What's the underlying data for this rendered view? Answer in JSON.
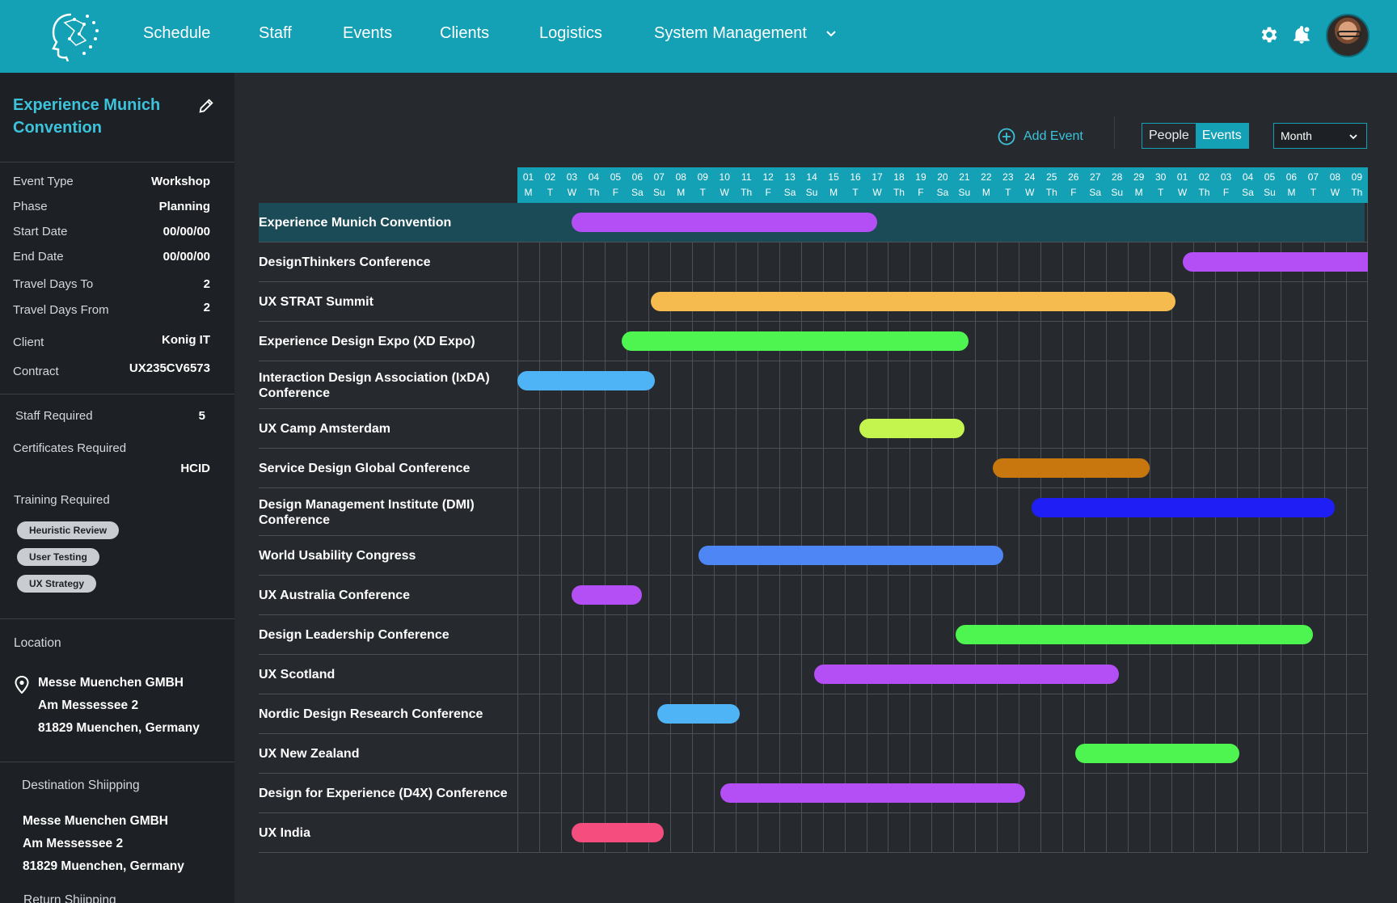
{
  "nav": {
    "items": [
      "Schedule",
      "Staff",
      "Events",
      "Clients",
      "Logistics",
      "System Management"
    ]
  },
  "event": {
    "title": "Experience Munich Convention",
    "details": [
      {
        "label": "Event Type",
        "value": "Workshop"
      },
      {
        "label": "Phase",
        "value": "Planning"
      },
      {
        "label": "Start Date",
        "value": "00/00/00"
      },
      {
        "label": "End Date",
        "value": "00/00/00"
      },
      {
        "label": "Travel Days To",
        "value": "2"
      },
      {
        "label": "Travel Days From",
        "value": "2"
      },
      {
        "label": "Client",
        "value": "Konig IT"
      },
      {
        "label": "Contract",
        "value": "UX235CV6573"
      }
    ],
    "staff_required_label": "Staff Required",
    "staff_required_value": "5",
    "certificates_label": "Certificates Required",
    "certificates_value": "HCID",
    "training_label": "Training Required",
    "training_chips": [
      "Heuristic Review",
      "User Testing",
      "UX Strategy"
    ],
    "location_label": "Location",
    "location_lines": [
      "Messe Muenchen GMBH",
      "Am Messessee 2",
      "81829 Muenchen, Germany"
    ],
    "dest_shipping_label": "Destination Shiipping",
    "dest_shipping_lines": [
      "Messe Muenchen GMBH",
      "Am Messessee 2",
      "81829 Muenchen, Germany"
    ],
    "return_shipping_label": "Return Shiipping"
  },
  "toolbar": {
    "add_event_label": "Add Event",
    "toggle": [
      "People",
      "Events"
    ],
    "active_toggle": "Events",
    "view_select": "Month"
  },
  "days": [
    {
      "d": "01",
      "w": "M"
    },
    {
      "d": "02",
      "w": "T"
    },
    {
      "d": "03",
      "w": "W"
    },
    {
      "d": "04",
      "w": "Th"
    },
    {
      "d": "05",
      "w": "F"
    },
    {
      "d": "06",
      "w": "Sa"
    },
    {
      "d": "07",
      "w": "Su"
    },
    {
      "d": "08",
      "w": "M"
    },
    {
      "d": "09",
      "w": "T"
    },
    {
      "d": "10",
      "w": "W"
    },
    {
      "d": "11",
      "w": "Th"
    },
    {
      "d": "12",
      "w": "F"
    },
    {
      "d": "13",
      "w": "Sa"
    },
    {
      "d": "14",
      "w": "Su"
    },
    {
      "d": "15",
      "w": "M"
    },
    {
      "d": "16",
      "w": "T"
    },
    {
      "d": "17",
      "w": "W"
    },
    {
      "d": "18",
      "w": "Th"
    },
    {
      "d": "19",
      "w": "F"
    },
    {
      "d": "20",
      "w": "Sa"
    },
    {
      "d": "21",
      "w": "Su"
    },
    {
      "d": "22",
      "w": "M"
    },
    {
      "d": "23",
      "w": "T"
    },
    {
      "d": "24",
      "w": "W"
    },
    {
      "d": "25",
      "w": "Th"
    },
    {
      "d": "26",
      "w": "F"
    },
    {
      "d": "27",
      "w": "Sa"
    },
    {
      "d": "28",
      "w": "Su"
    },
    {
      "d": "29",
      "w": "M"
    },
    {
      "d": "30",
      "w": "T"
    },
    {
      "d": "01",
      "w": "W"
    },
    {
      "d": "02",
      "w": "Th"
    },
    {
      "d": "03",
      "w": "F"
    },
    {
      "d": "04",
      "w": "Sa"
    },
    {
      "d": "05",
      "w": "Su"
    },
    {
      "d": "06",
      "w": "M"
    },
    {
      "d": "07",
      "w": "T"
    },
    {
      "d": "08",
      "w": "W"
    },
    {
      "d": "09",
      "w": "Th"
    }
  ],
  "events": [
    {
      "name": "Experience Munich Convention",
      "start": 2.5,
      "end": 16.5,
      "color": "#b44ef5",
      "selected": true
    },
    {
      "name": "DesignThinkers Conference",
      "start": 30.5,
      "end": 39,
      "color": "#b44ef5"
    },
    {
      "name": "UX STRAT Summit",
      "start": 6.1,
      "end": 30.2,
      "color": "#f5bb4e"
    },
    {
      "name": "Experience Design Expo (XD Expo)",
      "start": 4.8,
      "end": 20.7,
      "color": "#4ef551"
    },
    {
      "name": "Interaction Design Association (IxDA) Conference",
      "start": 0,
      "end": 6.3,
      "color": "#4eb4f5"
    },
    {
      "name": "UX Camp Amsterdam",
      "start": 15.7,
      "end": 20.5,
      "color": "#c4f54e"
    },
    {
      "name": "Service Design Global Conference",
      "start": 21.8,
      "end": 29,
      "color": "#c8770f"
    },
    {
      "name": "Design Management Institute (DMI) Conference",
      "start": 23.6,
      "end": 37.5,
      "color": "#1f1ff5"
    },
    {
      "name": "World Usability Congress",
      "start": 8.3,
      "end": 22.3,
      "color": "#4e87f5"
    },
    {
      "name": "UX Australia Conference",
      "start": 2.5,
      "end": 5.7,
      "color": "#b44ef5"
    },
    {
      "name": "Design Leadership Conference",
      "start": 20.1,
      "end": 36.5,
      "color": "#4ef551"
    },
    {
      "name": "UX Scotland",
      "start": 13.6,
      "end": 27.6,
      "color": "#b44ef5"
    },
    {
      "name": "Nordic Design Research Conference",
      "start": 6.4,
      "end": 10.2,
      "color": "#4eb4f5"
    },
    {
      "name": "UX New Zealand",
      "start": 25.6,
      "end": 33.1,
      "color": "#4ef551"
    },
    {
      "name": "Design for Experience (D4X) Conference",
      "start": 9.3,
      "end": 23.3,
      "color": "#b44ef5"
    },
    {
      "name": "UX India",
      "start": 2.5,
      "end": 6.7,
      "color": "#f54e7e"
    }
  ]
}
